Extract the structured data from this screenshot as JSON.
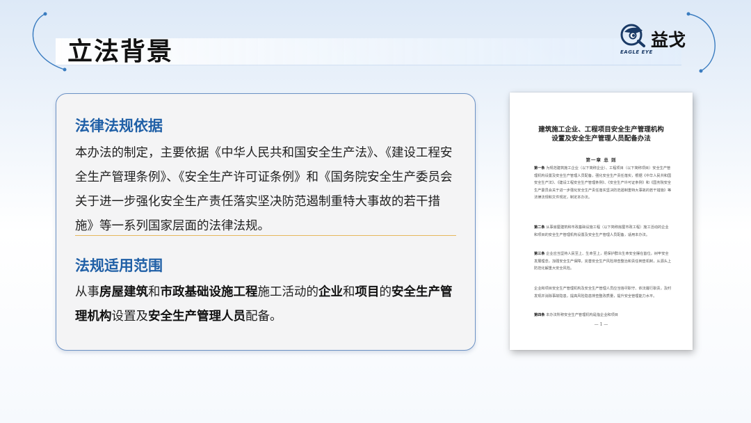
{
  "header": {
    "title": "立法背景",
    "logo": {
      "text": "益戈",
      "sub": "EAGLE EYE",
      "icon": "eagle-eye-icon"
    }
  },
  "card": {
    "section1": {
      "title": "法律法规依据",
      "body": "本办法的制定，主要依据《中华人民共和国安全生产法》、《建设工程安全生产管理条例》、《安全生产许可证条例》和《国务院安全生产委员会关于进一步强化安全生产责任落实坚决防范遏制重特大事故的若干措施》等一系列国家层面的法律法规。"
    },
    "section2": {
      "title": "法规适用范围",
      "parts": [
        "从事",
        "房屋建筑",
        "和",
        "市政基础设施工程",
        "施工活动的",
        "企业",
        "和",
        "项目",
        "的",
        "安全生产管理机构",
        "设置及",
        "安全生产管理人员",
        "配备。"
      ]
    }
  },
  "document": {
    "title_line1": "建筑施工企业、工程项目安全生产管理机构",
    "title_line2": "设置及安全生产管理人员配备办法",
    "chapter": "第一章  总  则",
    "paras": [
      {
        "label": "第一条",
        "text": "为规范建筑施工企业（以下简称企业）、工程项目（以下简称项目）安全生产管理机构设置及安全生产管理人员配备，强化安全生产责任落实，根据《中华人民共和国安全生产法》、《建设工程安全生产管理条例》、《安全生产许可证条例》和《国务院安全生产委员会关于进一步强化安全生产责任落实坚决防范遏制重特大事故的若干措施》等法律法规和文件规定，制定本办法。"
      },
      {
        "label": "第二条",
        "text": "从事房屋建筑和市政基础设施工程（以下简称房屋市政工程）施工活动的企业和项目的安全生产管理机构设置及安全生产管理人员配备，适用本办法。"
      },
      {
        "label": "第三条",
        "text": "企业应当坚持人民至上、生命至上，把保护群众生命安全摆在首位，树牢安全发展理念，加强安全生产保障，完善安全生产风险排查整治和责任倒查机制，从源头上防范化解重大安全风险。"
      },
      {
        "label": "",
        "text": "企业和项目安全生产管理机构及安全生产管理人员应当恪尽职守、依法履行职责，及时发现并消除事故隐患，提高风险隐患排查整改质量，提升安全管理能力水平。"
      },
      {
        "label": "第四条",
        "text": "本办法所称安全生产管理机构是指企业和项目"
      }
    ],
    "page_number": "— 1 —"
  },
  "colors": {
    "accent": "#1f5fa6",
    "border": "#6b91c4",
    "divider": "#e5b85c"
  }
}
